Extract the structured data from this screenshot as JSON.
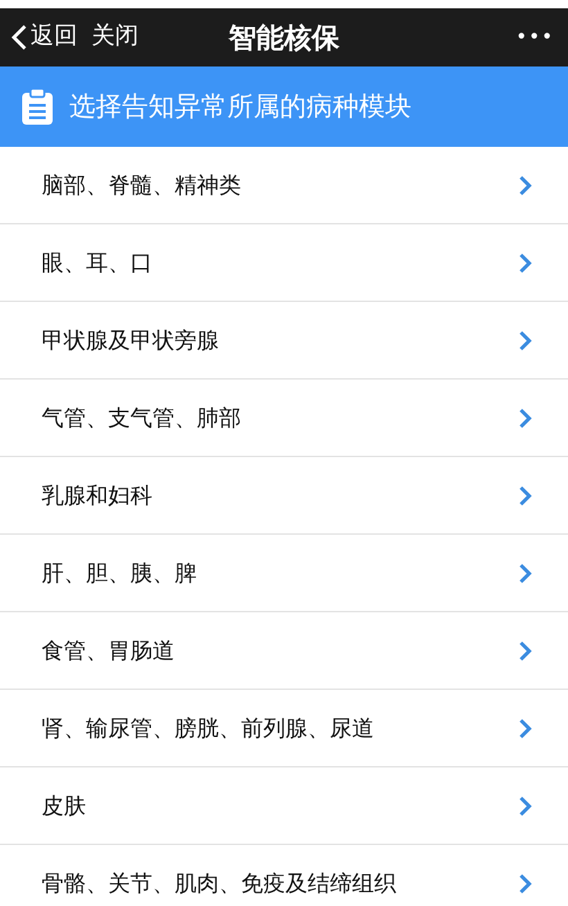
{
  "nav_bar": {
    "back": "返回",
    "close": "关闭",
    "title": "智能核保",
    "more": "•••"
  },
  "banner": {
    "text": "选择告知异常所属的病种模块"
  },
  "items": [
    {
      "label": "脑部、脊髓、精神类"
    },
    {
      "label": "眼、耳、口"
    },
    {
      "label": "甲状腺及甲状旁腺"
    },
    {
      "label": "气管、支气管、肺部"
    },
    {
      "label": "乳腺和妇科"
    },
    {
      "label": "肝、胆、胰、脾"
    },
    {
      "label": "食管、胃肠道"
    },
    {
      "label": "肾、输尿管、膀胱、前列腺、尿道"
    },
    {
      "label": "皮肤"
    },
    {
      "label": "骨骼、关节、肌肉、免疫及结缔组织"
    }
  ]
}
